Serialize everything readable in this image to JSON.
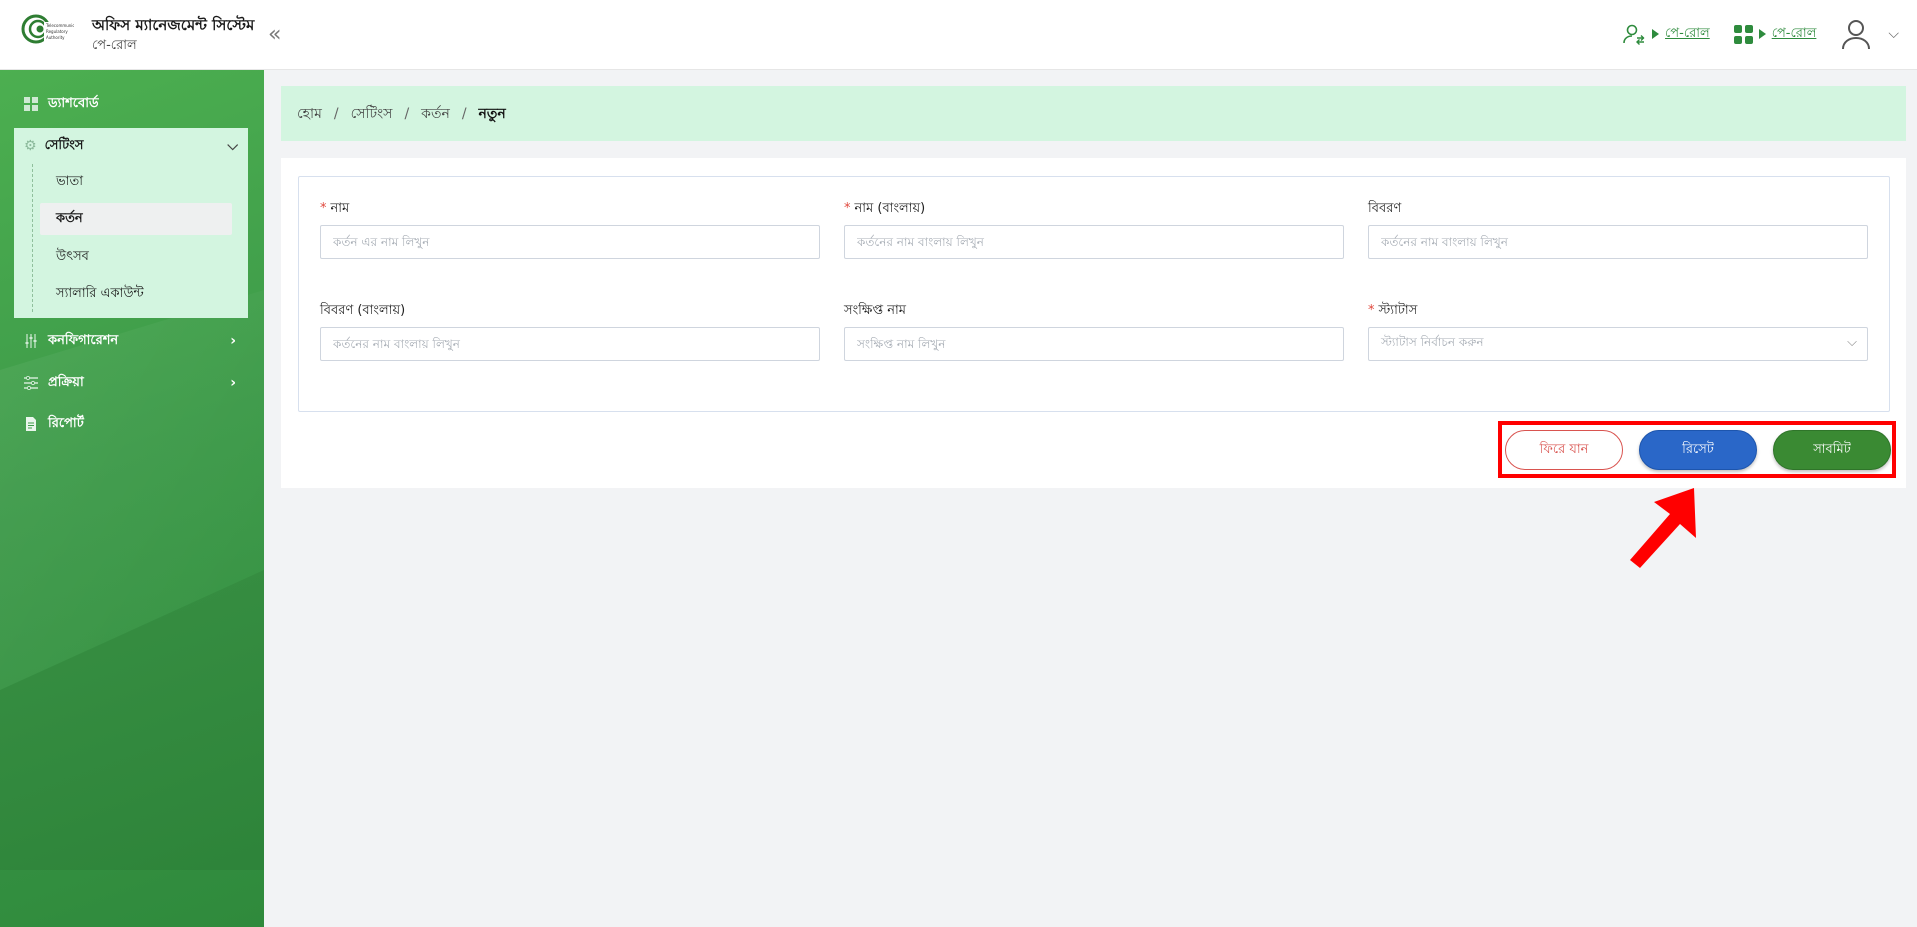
{
  "header": {
    "logo_text": "Bangladesh Telecommunication Regulatory Authority",
    "app_title": "অফিস ম্যানেজমেন্ট সিস্টেম",
    "app_subtitle": "পে-রোল",
    "collapse_icon": "double-chevron-left-icon",
    "links": [
      {
        "icon": "user-switch-icon",
        "label": "পে-রোল"
      },
      {
        "icon": "apps-grid-icon",
        "label": "পে-রোল"
      }
    ],
    "profile_icon": "user-avatar-icon",
    "accent_color": "#2e8b3d"
  },
  "sidebar": {
    "items": [
      {
        "icon": "dashboard-icon",
        "label": "ড্যাশবোর্ড"
      },
      {
        "icon": "gear-icon",
        "label": "সেটিংস",
        "expanded": true,
        "children": [
          {
            "label": "ভাতা"
          },
          {
            "label": "কর্তন",
            "active": true
          },
          {
            "label": "উৎসব"
          },
          {
            "label": "স্যালারি একাউন্ট"
          }
        ]
      },
      {
        "icon": "sliders-icon",
        "label": "কনফিগারেশন"
      },
      {
        "icon": "filter-list-icon",
        "label": "প্রক্রিয়া"
      },
      {
        "icon": "report-icon",
        "label": "রিপোর্ট"
      }
    ]
  },
  "breadcrumb": [
    "হোম",
    "সেটিংস",
    "কর্তন",
    "নতুন"
  ],
  "form": {
    "fields": [
      {
        "label": "নাম",
        "required": true,
        "placeholder": "কর্তন এর নাম লিখুন",
        "value": ""
      },
      {
        "label": "নাম (বাংলায়)",
        "required": true,
        "placeholder": "কর্তনের নাম বাংলায় লিখুন",
        "value": ""
      },
      {
        "label": "বিবরণ",
        "required": false,
        "placeholder": "কর্তনের নাম বাংলায় লিখুন",
        "value": ""
      },
      {
        "label": "বিবরণ (বাংলায়)",
        "required": false,
        "placeholder": "কর্তনের নাম বাংলায় লিখুন",
        "value": ""
      },
      {
        "label": "সংক্ষিপ্ত নাম",
        "required": false,
        "placeholder": "সংক্ষিপ্ত নাম লিখুন",
        "value": ""
      },
      {
        "label": "স্ট্যাটাস",
        "required": true,
        "placeholder": "স্ট্যাটাস নির্বাচন করুন",
        "value": ""
      }
    ],
    "required_mark": "*",
    "buttons": {
      "back": "ফিরে যান",
      "reset": "রিসেট",
      "submit": "সাবমিট"
    }
  }
}
